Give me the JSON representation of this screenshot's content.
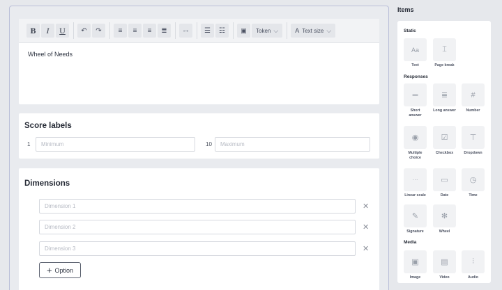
{
  "toolbar": {
    "token_label": "Token",
    "text_size_label": "Text size"
  },
  "editor": {
    "content": "Wheel of Needs"
  },
  "score_labels": {
    "title": "Score labels",
    "min_number": "1",
    "min_placeholder": "Minimum",
    "max_number": "10",
    "max_placeholder": "Maximum"
  },
  "dimensions": {
    "title": "Dimensions",
    "items": [
      {
        "placeholder": "Dimension 1"
      },
      {
        "placeholder": "Dimension 2"
      },
      {
        "placeholder": "Dimension 3"
      }
    ],
    "option_label": "Option"
  },
  "items_panel": {
    "title": "Items",
    "sections": {
      "static": "Static",
      "responses": "Responses",
      "media": "Media"
    },
    "static_items": [
      {
        "label": "Text",
        "icon": "text-icon"
      },
      {
        "label": "Page break",
        "icon": "page-break-icon"
      }
    ],
    "response_items": [
      {
        "label": "Short answer",
        "icon": "short-answer-icon"
      },
      {
        "label": "Long answer",
        "icon": "long-answer-icon"
      },
      {
        "label": "Number",
        "icon": "number-icon"
      },
      {
        "label": "Multiple choice",
        "icon": "multiple-choice-icon"
      },
      {
        "label": "Checkbox",
        "icon": "checkbox-icon"
      },
      {
        "label": "Dropdown",
        "icon": "dropdown-icon"
      },
      {
        "label": "Linear scale",
        "icon": "linear-scale-icon"
      },
      {
        "label": "Date",
        "icon": "date-icon"
      },
      {
        "label": "Time",
        "icon": "time-icon"
      },
      {
        "label": "Signature",
        "icon": "signature-icon"
      },
      {
        "label": "Wheel",
        "icon": "wheel-icon"
      }
    ],
    "media_items": [
      {
        "label": "Image",
        "icon": "image-icon"
      },
      {
        "label": "Video",
        "icon": "video-icon"
      },
      {
        "label": "Audio",
        "icon": "audio-icon"
      }
    ]
  }
}
